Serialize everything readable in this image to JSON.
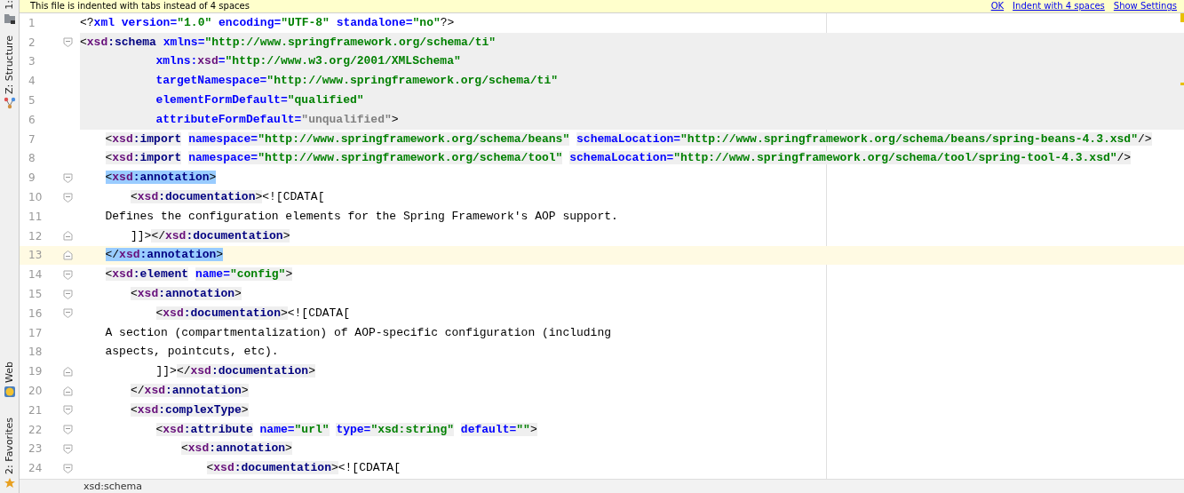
{
  "tool_strip": [
    {
      "label": "1:"
    },
    {
      "label": "Z: Structure"
    },
    {
      "label": "Web"
    },
    {
      "label": "2: Favorites"
    }
  ],
  "banner": {
    "message": "This file is indented with tabs instead of 4 spaces",
    "links": [
      "OK",
      "Indent with 4 spaces",
      "Show Settings"
    ]
  },
  "lines": [
    {
      "number": "1",
      "tokens": [
        {
          "kind": "p",
          "text": "<?"
        },
        {
          "kind": "attr",
          "text": "xml version="
        },
        {
          "kind": "val",
          "text": "\"1.0\""
        },
        {
          "kind": "attr",
          "text": " encoding="
        },
        {
          "kind": "val",
          "text": "\"UTF-8\""
        },
        {
          "kind": "attr",
          "text": " standalone="
        },
        {
          "kind": "val",
          "text": "\"no\""
        },
        {
          "kind": "p",
          "text": "?>"
        }
      ]
    },
    {
      "number": "2",
      "band": true,
      "fold_start": true,
      "tokens": [
        {
          "kind": "p",
          "text": "<"
        },
        {
          "kind": "ns",
          "text": "xsd"
        },
        {
          "kind": "tag",
          "text": ":schema"
        },
        {
          "kind": "attr",
          "text": " xmlns="
        },
        {
          "kind": "val",
          "text": "\"http://www.springframework.org/schema/ti\""
        }
      ]
    },
    {
      "number": "3",
      "band": true,
      "tokens": [
        {
          "kind": "attr",
          "text": "\t\t\txmlns:"
        },
        {
          "kind": "ns",
          "text": "xsd"
        },
        {
          "kind": "attr",
          "text": "="
        },
        {
          "kind": "val",
          "text": "\"http://www.w3.org/2001/XMLSchema\""
        }
      ]
    },
    {
      "number": "4",
      "band": true,
      "tokens": [
        {
          "kind": "attr",
          "text": "\t\t\ttargetNamespace="
        },
        {
          "kind": "val",
          "text": "\"http://www.springframework.org/schema/ti\""
        }
      ]
    },
    {
      "number": "5",
      "band": true,
      "tokens": [
        {
          "kind": "attr",
          "text": "\t\t\telementFormDefault="
        },
        {
          "kind": "val",
          "text": "\"qualified\""
        }
      ]
    },
    {
      "number": "6",
      "band": true,
      "tokens": [
        {
          "kind": "attr",
          "text": "\t\t\tattributeFormDefault="
        },
        {
          "kind": "dim",
          "text": "\"unqualified\""
        },
        {
          "kind": "p",
          "text": ">"
        }
      ]
    },
    {
      "number": "7",
      "tags_shaded": true,
      "tokens": [
        {
          "kind": "p",
          "text": "\t<"
        },
        {
          "kind": "ns",
          "text": "xsd"
        },
        {
          "kind": "tag",
          "text": ":import"
        },
        {
          "kind": "attr",
          "text": " namespace="
        },
        {
          "kind": "val",
          "text": "\"http://www.springframework.org/schema/beans\""
        },
        {
          "kind": "attr",
          "text": " schemaLocation="
        },
        {
          "kind": "val",
          "text": "\"http://www.springframework.org/schema/beans/spring-beans-4.3.xsd\""
        },
        {
          "kind": "p",
          "text": "/>"
        }
      ]
    },
    {
      "number": "8",
      "tags_shaded": true,
      "tokens": [
        {
          "kind": "p",
          "text": "\t<"
        },
        {
          "kind": "ns",
          "text": "xsd"
        },
        {
          "kind": "tag",
          "text": ":import"
        },
        {
          "kind": "attr",
          "text": " namespace="
        },
        {
          "kind": "val",
          "text": "\"http://www.springframework.org/schema/tool\""
        },
        {
          "kind": "attr",
          "text": " schemaLocation="
        },
        {
          "kind": "val",
          "text": "\"http://www.springframework.org/schema/tool/spring-tool-4.3.xsd\""
        },
        {
          "kind": "p",
          "text": "/>"
        }
      ]
    },
    {
      "number": "9",
      "matched": true,
      "fold_start": true,
      "tokens": [
        {
          "kind": "p",
          "text": "\t<"
        },
        {
          "kind": "ns",
          "text": "xsd"
        },
        {
          "kind": "tag",
          "text": ":annotation"
        },
        {
          "kind": "p",
          "text": ">"
        }
      ]
    },
    {
      "number": "10",
      "tags_shaded": true,
      "fold_start": true,
      "tokens": [
        {
          "kind": "p",
          "text": "\t\t<"
        },
        {
          "kind": "ns",
          "text": "xsd"
        },
        {
          "kind": "tag",
          "text": ":documentation"
        },
        {
          "kind": "p",
          "text": ">"
        },
        {
          "kind": "text",
          "text": "<![CDATA["
        }
      ]
    },
    {
      "number": "11",
      "tokens": [
        {
          "kind": "text",
          "text": "\tDefines the configuration elements for the Spring Framework's AOP support."
        }
      ]
    },
    {
      "number": "12",
      "tags_shaded": true,
      "fold_end": true,
      "tokens": [
        {
          "kind": "text",
          "text": "\t\t]]>"
        },
        {
          "kind": "p",
          "text": "</"
        },
        {
          "kind": "ns",
          "text": "xsd"
        },
        {
          "kind": "tag",
          "text": ":documentation"
        },
        {
          "kind": "p",
          "text": ">"
        }
      ]
    },
    {
      "number": "13",
      "matched": true,
      "current": true,
      "fold_end": true,
      "tokens": [
        {
          "kind": "p",
          "text": "\t</"
        },
        {
          "kind": "ns",
          "text": "xsd"
        },
        {
          "kind": "tag",
          "text": ":annotation"
        },
        {
          "kind": "p",
          "text": ">"
        }
      ]
    },
    {
      "number": "14",
      "tags_shaded": true,
      "fold_start": true,
      "tokens": [
        {
          "kind": "p",
          "text": "\t<"
        },
        {
          "kind": "ns",
          "text": "xsd"
        },
        {
          "kind": "tag",
          "text": ":element"
        },
        {
          "kind": "attr",
          "text": " name="
        },
        {
          "kind": "val",
          "text": "\"config\""
        },
        {
          "kind": "p",
          "text": ">"
        }
      ]
    },
    {
      "number": "15",
      "tags_shaded": true,
      "fold_start": true,
      "tokens": [
        {
          "kind": "p",
          "text": "\t\t<"
        },
        {
          "kind": "ns",
          "text": "xsd"
        },
        {
          "kind": "tag",
          "text": ":annotation"
        },
        {
          "kind": "p",
          "text": ">"
        }
      ]
    },
    {
      "number": "16",
      "tags_shaded": true,
      "fold_start": true,
      "tokens": [
        {
          "kind": "p",
          "text": "\t\t\t<"
        },
        {
          "kind": "ns",
          "text": "xsd"
        },
        {
          "kind": "tag",
          "text": ":documentation"
        },
        {
          "kind": "p",
          "text": ">"
        },
        {
          "kind": "text",
          "text": "<![CDATA["
        }
      ]
    },
    {
      "number": "17",
      "tokens": [
        {
          "kind": "text",
          "text": "\tA section (compartmentalization) of AOP-specific configuration (including"
        }
      ]
    },
    {
      "number": "18",
      "tokens": [
        {
          "kind": "text",
          "text": "\taspects, pointcuts, etc)."
        }
      ]
    },
    {
      "number": "19",
      "tags_shaded": true,
      "fold_end": true,
      "tokens": [
        {
          "kind": "text",
          "text": "\t\t\t]]>"
        },
        {
          "kind": "p",
          "text": "</"
        },
        {
          "kind": "ns",
          "text": "xsd"
        },
        {
          "kind": "tag",
          "text": ":documentation"
        },
        {
          "kind": "p",
          "text": ">"
        }
      ]
    },
    {
      "number": "20",
      "tags_shaded": true,
      "fold_end": true,
      "tokens": [
        {
          "kind": "p",
          "text": "\t\t</"
        },
        {
          "kind": "ns",
          "text": "xsd"
        },
        {
          "kind": "tag",
          "text": ":annotation"
        },
        {
          "kind": "p",
          "text": ">"
        }
      ]
    },
    {
      "number": "21",
      "tags_shaded": true,
      "fold_start": true,
      "tokens": [
        {
          "kind": "p",
          "text": "\t\t<"
        },
        {
          "kind": "ns",
          "text": "xsd"
        },
        {
          "kind": "tag",
          "text": ":complexType"
        },
        {
          "kind": "p",
          "text": ">"
        }
      ]
    },
    {
      "number": "22",
      "tags_shaded": true,
      "fold_start": true,
      "tokens": [
        {
          "kind": "p",
          "text": "\t\t\t<"
        },
        {
          "kind": "ns",
          "text": "xsd"
        },
        {
          "kind": "tag",
          "text": ":attribute"
        },
        {
          "kind": "attr",
          "text": " name="
        },
        {
          "kind": "val",
          "text": "\"url\""
        },
        {
          "kind": "attr",
          "text": " type="
        },
        {
          "kind": "val",
          "text": "\"xsd:string\""
        },
        {
          "kind": "attr",
          "text": " default="
        },
        {
          "kind": "val",
          "text": "\"\""
        },
        {
          "kind": "p",
          "text": ">"
        }
      ]
    },
    {
      "number": "23",
      "tags_shaded": true,
      "fold_start": true,
      "tokens": [
        {
          "kind": "p",
          "text": "\t\t\t\t<"
        },
        {
          "kind": "ns",
          "text": "xsd"
        },
        {
          "kind": "tag",
          "text": ":annotation"
        },
        {
          "kind": "p",
          "text": ">"
        }
      ]
    },
    {
      "number": "24",
      "tags_shaded": true,
      "fold_start": true,
      "tokens": [
        {
          "kind": "p",
          "text": "\t\t\t\t\t<"
        },
        {
          "kind": "ns",
          "text": "xsd"
        },
        {
          "kind": "tag",
          "text": ":documentation"
        },
        {
          "kind": "p",
          "text": ">"
        },
        {
          "kind": "text",
          "text": "<![CDATA["
        }
      ]
    }
  ],
  "breadcrumb": "xsd:schema"
}
